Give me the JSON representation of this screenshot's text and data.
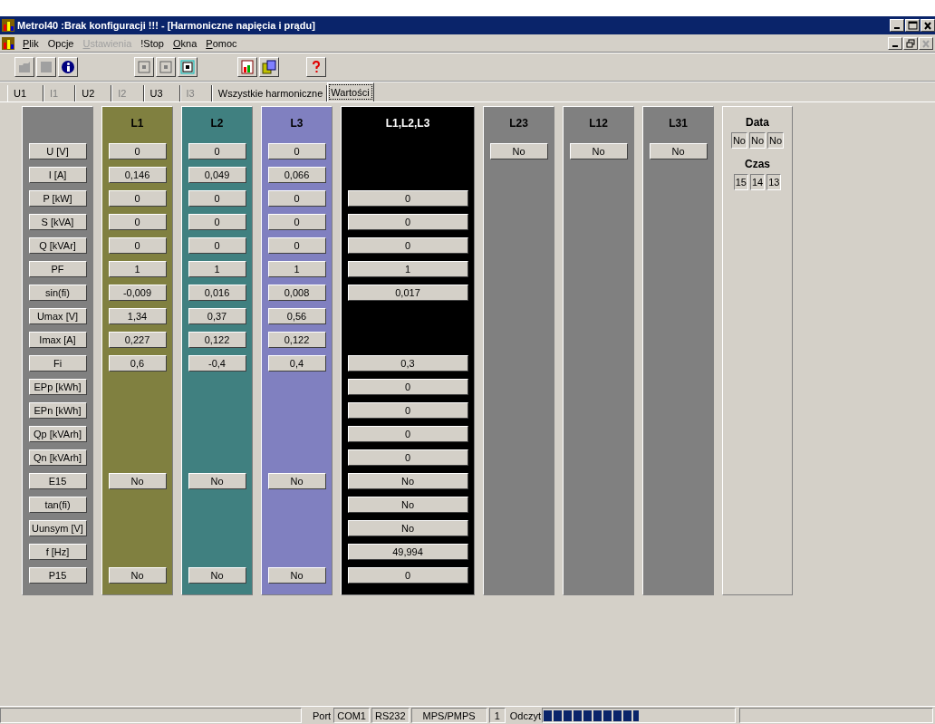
{
  "window": {
    "title": "Metrol40 :Brak konfiguracji !!! - [Harmoniczne napięcia i prądu]"
  },
  "menu": [
    {
      "label": "Plik",
      "mnemonic": true,
      "disabled": false
    },
    {
      "label": "Opcje",
      "mnemonic": false,
      "disabled": false
    },
    {
      "label": "Ustawienia",
      "mnemonic": true,
      "disabled": true
    },
    {
      "label": "!Stop",
      "mnemonic": false,
      "disabled": false
    },
    {
      "label": "Okna",
      "mnemonic": true,
      "disabled": false
    },
    {
      "label": "Pomoc",
      "mnemonic": true,
      "disabled": false
    }
  ],
  "tabs": [
    {
      "label": "U1",
      "selected": false,
      "disabled": false
    },
    {
      "label": "I1",
      "selected": false,
      "disabled": true
    },
    {
      "label": "U2",
      "selected": false,
      "disabled": false
    },
    {
      "label": "I2",
      "selected": false,
      "disabled": true
    },
    {
      "label": "U3",
      "selected": false,
      "disabled": false
    },
    {
      "label": "I3",
      "selected": false,
      "disabled": true
    },
    {
      "label": "Wszystkie harmoniczne",
      "selected": false,
      "disabled": false
    },
    {
      "label": "Wartości",
      "selected": true,
      "disabled": false
    }
  ],
  "table": {
    "row_labels": [
      "U [V]",
      "I [A]",
      "P [kW]",
      "S [kVA]",
      "Q [kVAr]",
      "PF",
      "sin(fi)",
      "Umax [V]",
      "Imax [A]",
      "Fi",
      "EPp [kWh]",
      "EPn [kWh]",
      "Qp [kVArh]",
      "Qn [kVArh]",
      "E15",
      "tan(fi)",
      "Uunsym [V]",
      "f [Hz]",
      "P15"
    ],
    "columns": [
      {
        "name": "L1",
        "color": "#808040",
        "cells": [
          {
            "kind": "field",
            "text": "0"
          },
          {
            "kind": "field",
            "text": "0,146"
          },
          {
            "kind": "field",
            "text": "0"
          },
          {
            "kind": "field",
            "text": "0"
          },
          {
            "kind": "field",
            "text": "0"
          },
          {
            "kind": "field",
            "text": "1"
          },
          {
            "kind": "field",
            "text": "-0,009"
          },
          {
            "kind": "field",
            "text": "1,34"
          },
          {
            "kind": "field",
            "text": "0,227"
          },
          {
            "kind": "field",
            "text": "0,6"
          },
          {
            "kind": "blank"
          },
          {
            "kind": "blank"
          },
          {
            "kind": "blank"
          },
          {
            "kind": "blank"
          },
          {
            "kind": "field",
            "text": "No"
          },
          {
            "kind": "blank"
          },
          {
            "kind": "blank"
          },
          {
            "kind": "blank"
          },
          {
            "kind": "field",
            "text": "No"
          }
        ]
      },
      {
        "name": "L2",
        "color": "#408080",
        "cells": [
          {
            "kind": "field",
            "text": "0"
          },
          {
            "kind": "field",
            "text": "0,049"
          },
          {
            "kind": "field",
            "text": "0"
          },
          {
            "kind": "field",
            "text": "0"
          },
          {
            "kind": "field",
            "text": "0"
          },
          {
            "kind": "field",
            "text": "1"
          },
          {
            "kind": "field",
            "text": "0,016"
          },
          {
            "kind": "field",
            "text": "0,37"
          },
          {
            "kind": "field",
            "text": "0,122"
          },
          {
            "kind": "field",
            "text": "-0,4"
          },
          {
            "kind": "blank"
          },
          {
            "kind": "blank"
          },
          {
            "kind": "blank"
          },
          {
            "kind": "blank"
          },
          {
            "kind": "field",
            "text": "No"
          },
          {
            "kind": "blank"
          },
          {
            "kind": "blank"
          },
          {
            "kind": "blank"
          },
          {
            "kind": "field",
            "text": "No"
          }
        ]
      },
      {
        "name": "L3",
        "color": "#8080c0",
        "cells": [
          {
            "kind": "field",
            "text": "0"
          },
          {
            "kind": "field",
            "text": "0,066"
          },
          {
            "kind": "field",
            "text": "0"
          },
          {
            "kind": "field",
            "text": "0"
          },
          {
            "kind": "field",
            "text": "0"
          },
          {
            "kind": "field",
            "text": "1"
          },
          {
            "kind": "field",
            "text": "0,008"
          },
          {
            "kind": "field",
            "text": "0,56"
          },
          {
            "kind": "field",
            "text": "0,122"
          },
          {
            "kind": "field",
            "text": "0,4"
          },
          {
            "kind": "blank"
          },
          {
            "kind": "blank"
          },
          {
            "kind": "blank"
          },
          {
            "kind": "blank"
          },
          {
            "kind": "field",
            "text": "No"
          },
          {
            "kind": "blank"
          },
          {
            "kind": "blank"
          },
          {
            "kind": "blank"
          },
          {
            "kind": "field",
            "text": "No"
          }
        ]
      },
      {
        "name": "L1,L2,L3",
        "color": "#000000",
        "cells": [
          {
            "kind": "blank"
          },
          {
            "kind": "blank"
          },
          {
            "kind": "field",
            "text": "0"
          },
          {
            "kind": "field",
            "text": "0"
          },
          {
            "kind": "field",
            "text": "0"
          },
          {
            "kind": "field",
            "text": "1"
          },
          {
            "kind": "field",
            "text": "0,017"
          },
          {
            "kind": "blank"
          },
          {
            "kind": "blank"
          },
          {
            "kind": "field",
            "text": "0,3"
          },
          {
            "kind": "field",
            "text": "0"
          },
          {
            "kind": "field",
            "text": "0"
          },
          {
            "kind": "field",
            "text": "0"
          },
          {
            "kind": "field",
            "text": "0"
          },
          {
            "kind": "field",
            "text": "No"
          },
          {
            "kind": "field",
            "text": "No"
          },
          {
            "kind": "field",
            "text": "No"
          },
          {
            "kind": "field",
            "text": "49,994"
          },
          {
            "kind": "field",
            "text": "0"
          }
        ]
      },
      {
        "name": "L23",
        "color": "#808080",
        "cells": [
          {
            "kind": "field",
            "text": "No"
          }
        ]
      },
      {
        "name": "L12",
        "color": "#808080",
        "cells": [
          {
            "kind": "field",
            "text": "No"
          }
        ]
      },
      {
        "name": "L31",
        "color": "#808080",
        "cells": [
          {
            "kind": "field",
            "text": "No"
          }
        ]
      }
    ]
  },
  "date_panel": {
    "date_label": "Data",
    "date_values": [
      "No",
      "No",
      "No"
    ],
    "time_label": "Czas",
    "time_values": [
      "15",
      "14",
      "13"
    ]
  },
  "status_bar": {
    "port_label": "Port",
    "port": "COM1",
    "interface": "RS232",
    "protocol": "MPS/PMPS",
    "address": "1",
    "read_label": "Odczyt",
    "read_progress": {
      "level": 0.5
    }
  }
}
